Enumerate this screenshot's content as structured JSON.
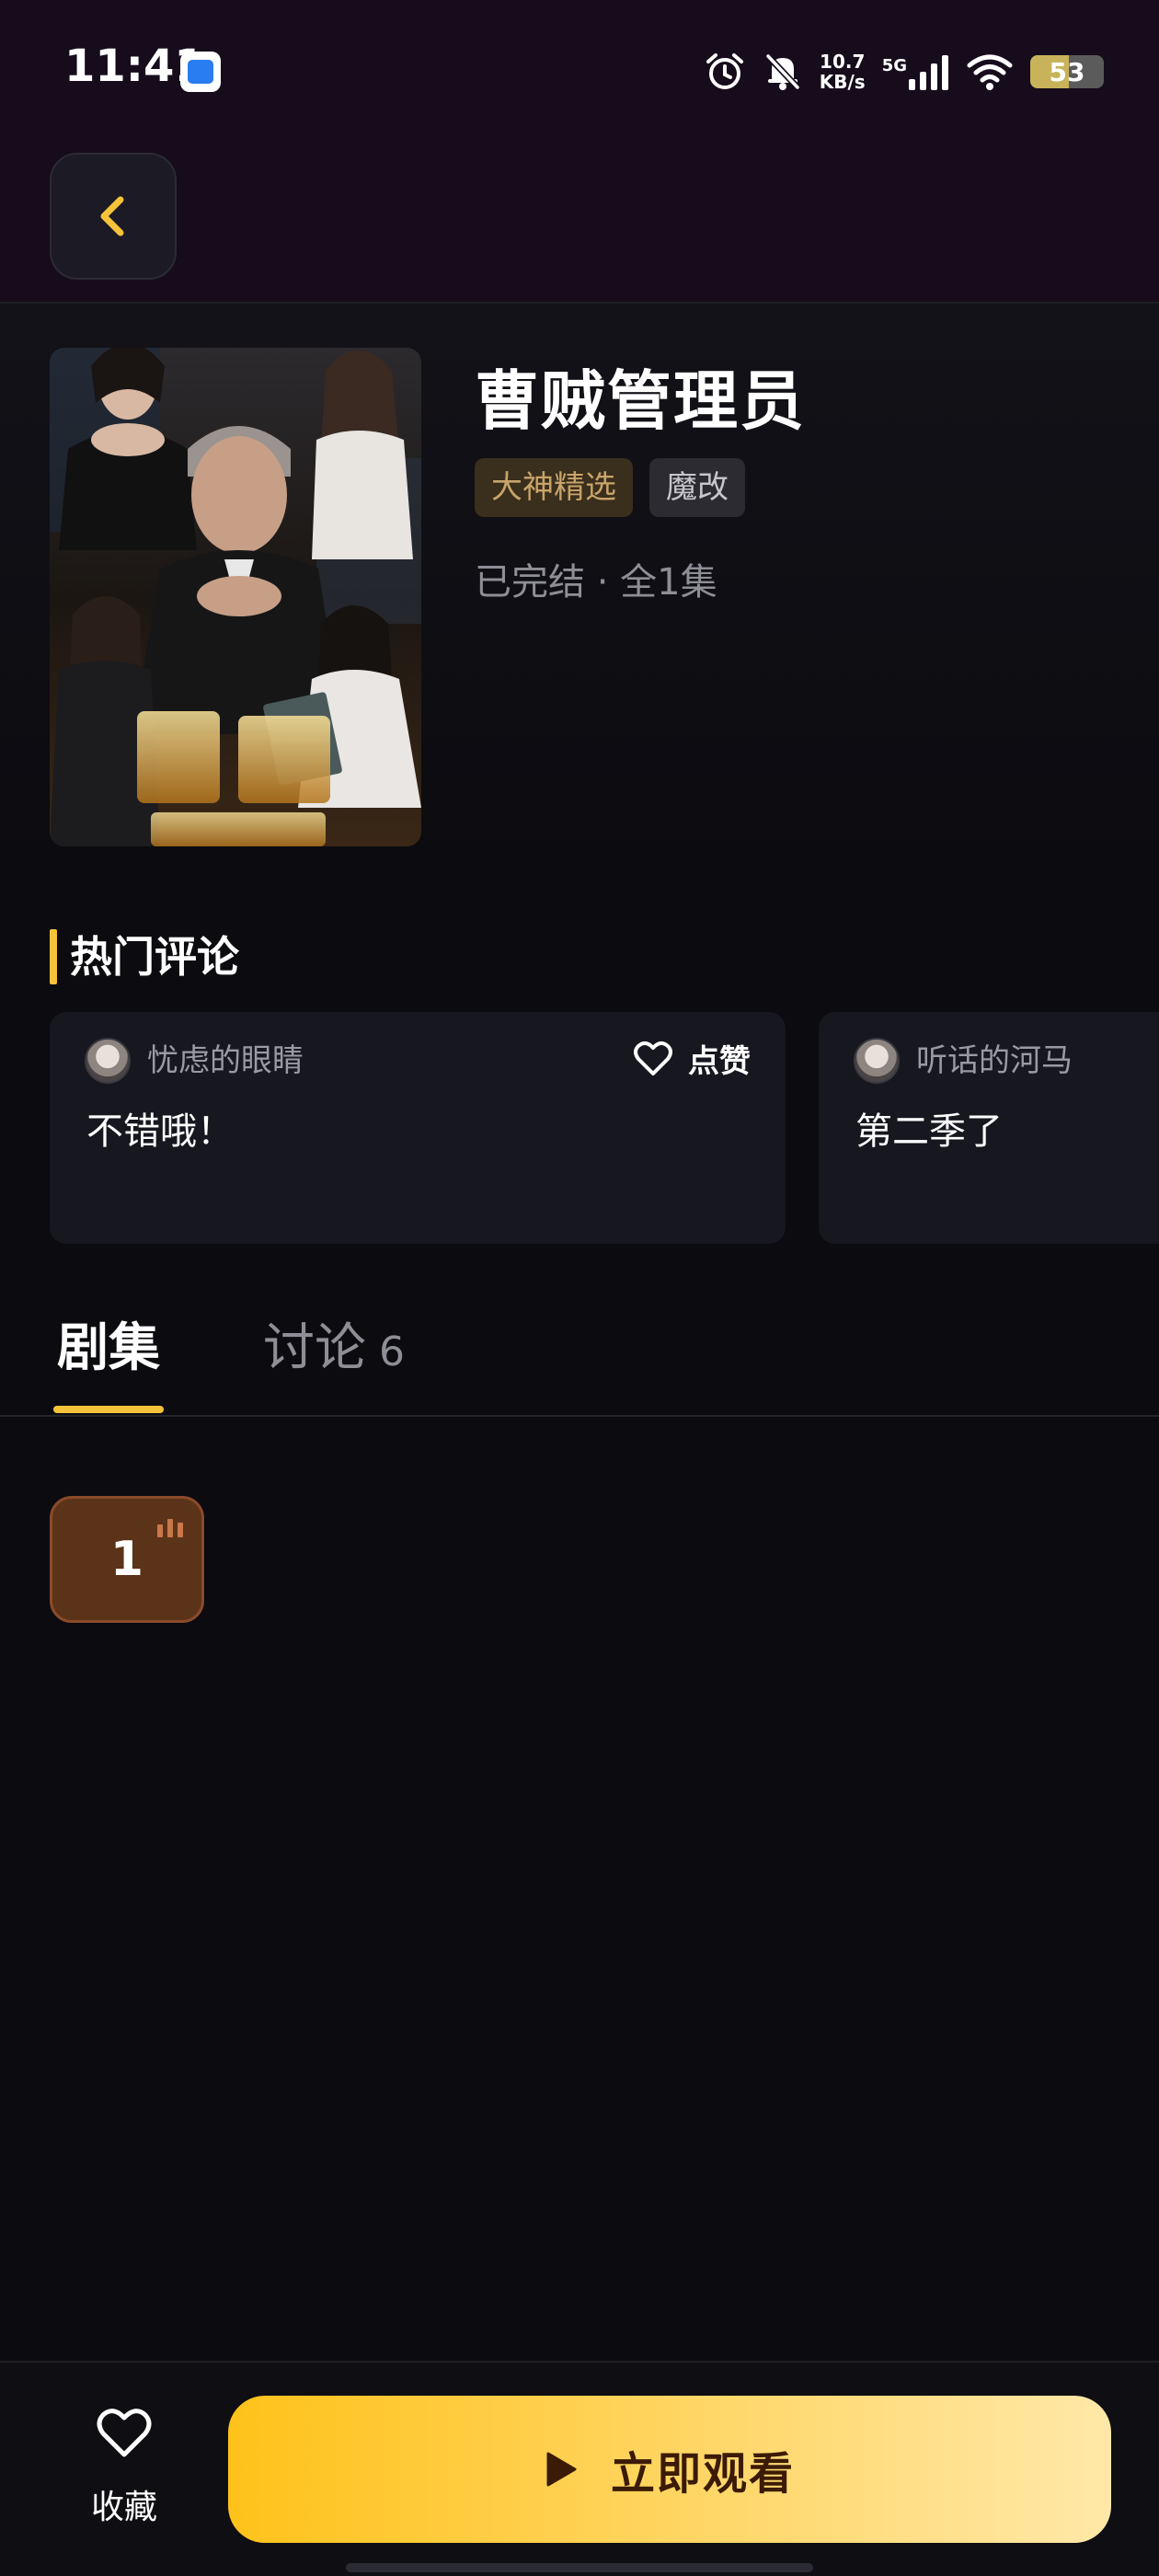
{
  "status_bar": {
    "time": "11:41",
    "net_speed_value": "10.7",
    "net_speed_unit": "KB/s",
    "network_type": "5G",
    "battery_level": "53",
    "battery_fraction": 0.53
  },
  "drama": {
    "title": "曹贼管理员",
    "tags": [
      "大神精选",
      "魔改"
    ],
    "status": "已完结 · 全1集"
  },
  "hot_comments": {
    "section_title": "热门评论",
    "like_label": "点赞",
    "items": [
      {
        "user": "忧虑的眼睛",
        "text": "不错哦！"
      },
      {
        "user": "听话的河马",
        "text": "第二季了"
      }
    ]
  },
  "tabs": [
    {
      "label": "剧集",
      "active": true
    },
    {
      "label": "讨论",
      "count": "6",
      "active": false
    }
  ],
  "episodes": [
    {
      "number": "1",
      "playing": true
    }
  ],
  "bottom": {
    "favorite_label": "收藏",
    "watch_label": "立即观看"
  },
  "colors": {
    "accent": "#f5c33a",
    "background": "#0b0b10",
    "header": "#160c1c"
  }
}
